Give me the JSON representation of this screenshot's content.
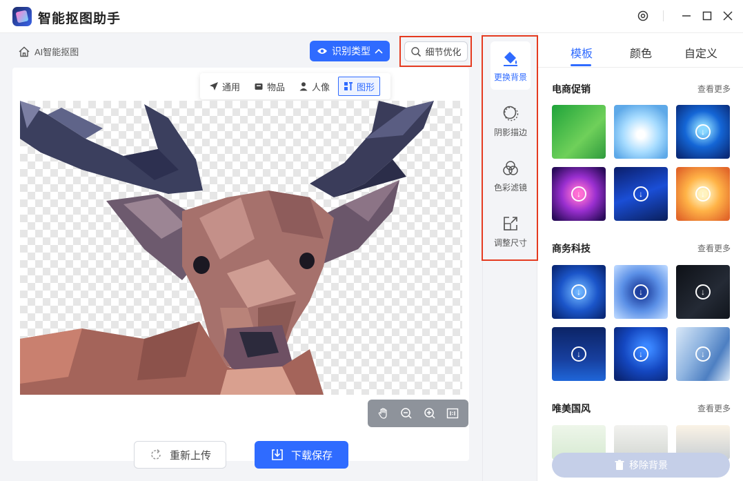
{
  "app": {
    "title": "智能抠图助手"
  },
  "breadcrumb": {
    "label": "AI智能抠图"
  },
  "toolbar": {
    "recognize_label": "识别类型",
    "detail_label": "细节优化"
  },
  "type_tabs": [
    {
      "label": "通用",
      "icon": "send-arrow-icon"
    },
    {
      "label": "物品",
      "icon": "box-icon"
    },
    {
      "label": "人像",
      "icon": "person-icon"
    },
    {
      "label": "图形",
      "icon": "shapes-icon",
      "active": true
    }
  ],
  "zoom_controls": [
    "hand-icon",
    "zoom-out-icon",
    "zoom-in-icon",
    "actual-size-icon"
  ],
  "actions": {
    "reupload_label": "重新上传",
    "download_label": "下载保存"
  },
  "tools": [
    {
      "label": "更换背景",
      "icon": "paint-bucket-icon",
      "active": true
    },
    {
      "label": "阴影描边",
      "icon": "shadow-circle-icon"
    },
    {
      "label": "色彩滤镜",
      "icon": "color-filter-icon"
    },
    {
      "label": "调整尺寸",
      "icon": "resize-icon"
    }
  ],
  "panel_tabs": [
    {
      "label": "模板",
      "active": true
    },
    {
      "label": "颜色"
    },
    {
      "label": "自定义"
    }
  ],
  "sections": [
    {
      "title": "电商促销",
      "more": "查看更多"
    },
    {
      "title": "商务科技",
      "more": "查看更多"
    },
    {
      "title": "唯美国风",
      "more": "查看更多"
    }
  ],
  "remove_bg_label": "移除背景",
  "colors": {
    "accent": "#2f6bff",
    "highlight": "#e53a1f"
  }
}
